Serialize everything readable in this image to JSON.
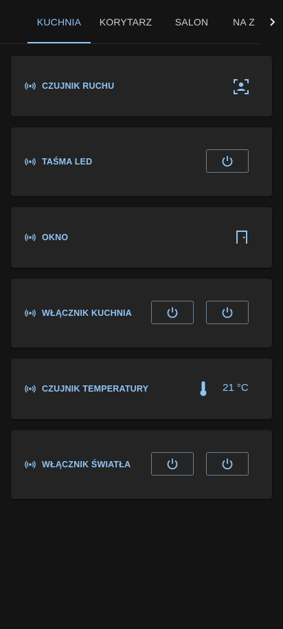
{
  "tabs": [
    {
      "label": "KUCHNIA",
      "active": true
    },
    {
      "label": "KORYTARZ",
      "active": false
    },
    {
      "label": "SALON",
      "active": false
    },
    {
      "label": "NA Z",
      "active": false
    }
  ],
  "cards": {
    "motion": {
      "label": "CZUJNIK RUCHU",
      "icon": "motion-sensor-icon"
    },
    "led": {
      "label": "TAŚMA LED",
      "icon": "power-icon"
    },
    "window": {
      "label": "OKNO",
      "icon": "door-icon"
    },
    "kitchen_switch": {
      "label": "WŁĄCZNIK KUCHNIA",
      "icon": "power-icon"
    },
    "temperature": {
      "label": "CZUJNIK TEMPERATURY",
      "icon": "thermometer-icon",
      "value": "21 °C"
    },
    "light_switch": {
      "label": "WŁĄCZNIK ŚWIATŁA",
      "icon": "power-icon"
    }
  },
  "colors": {
    "accent": "#8fc4f6",
    "background": "#141414",
    "card": "#242424"
  }
}
